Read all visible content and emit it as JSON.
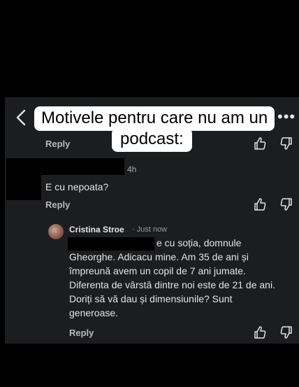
{
  "overlay": {
    "caption_line1": "Motivele pentru care nu am un",
    "caption_line2": "podcast:"
  },
  "header": {
    "back_icon": "chevron-left-icon",
    "more_icon": "more-horizontal-icon",
    "more_glyph": "•••"
  },
  "comments": [
    {
      "reply_label": "Reply"
    },
    {
      "time": "4h",
      "text": "E cu nepoata?",
      "reply_label": "Reply"
    }
  ],
  "reply": {
    "author": "Cristina Stroe",
    "time": "· Just now",
    "lines": [
      "e cu soția, domnule",
      "Gheorghe. Adicacu mine. Am 35 de ani și",
      "împreună avem un copil de 7 ani jumate.",
      "Diferenta de vârstă dintre noi este de 21 de ani.",
      "Doriți să vă dau și dimensiunile? Sunt",
      "generoase."
    ],
    "reply_label": "Reply"
  },
  "colors": {
    "panel": "#1c1d1f",
    "background": "#000000"
  }
}
